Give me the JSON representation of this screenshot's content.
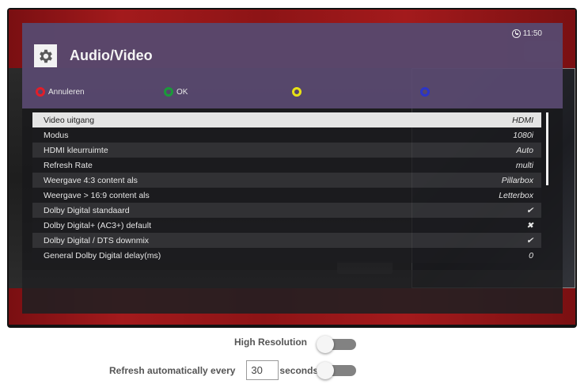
{
  "osd": {
    "clock": "11:50",
    "title": "Audio/Video",
    "buttons": [
      {
        "label": "Annuleren",
        "color": "#e01f2a"
      },
      {
        "label": "OK",
        "color": "#1b9a3a"
      },
      {
        "label": "",
        "color": "#e8e115"
      },
      {
        "label": "",
        "color": "#2c35c8"
      }
    ],
    "rows": [
      {
        "label": "Video uitgang",
        "value": "HDMI",
        "selected": true
      },
      {
        "label": "Modus",
        "value": "1080i"
      },
      {
        "label": "HDMI kleurruimte",
        "value": "Auto"
      },
      {
        "label": "Refresh Rate",
        "value": "multi"
      },
      {
        "label": "Weergave 4:3 content als",
        "value": "Pillarbox"
      },
      {
        "label": "Weergave > 16:9 content als",
        "value": "Letterbox"
      },
      {
        "label": "Dolby Digital standaard",
        "value": "✔"
      },
      {
        "label": "Dolby Digital+ (AC3+) default",
        "value": "✖"
      },
      {
        "label": "Dolby Digital / DTS downmix",
        "value": "✔"
      },
      {
        "label": "General Dolby Digital delay(ms)",
        "value": "0"
      }
    ]
  },
  "settings": {
    "high_resolution_label": "High Resolution",
    "high_resolution_enabled": false,
    "refresh_label": "Refresh automatically every",
    "refresh_value": "30",
    "refresh_unit": "seconds",
    "refresh_enabled": false
  },
  "colors": {
    "header": "#5f4e78",
    "selected_row": "#e4e4e4",
    "tv_red": "#a31a1c",
    "toggle_track": "#828282"
  }
}
